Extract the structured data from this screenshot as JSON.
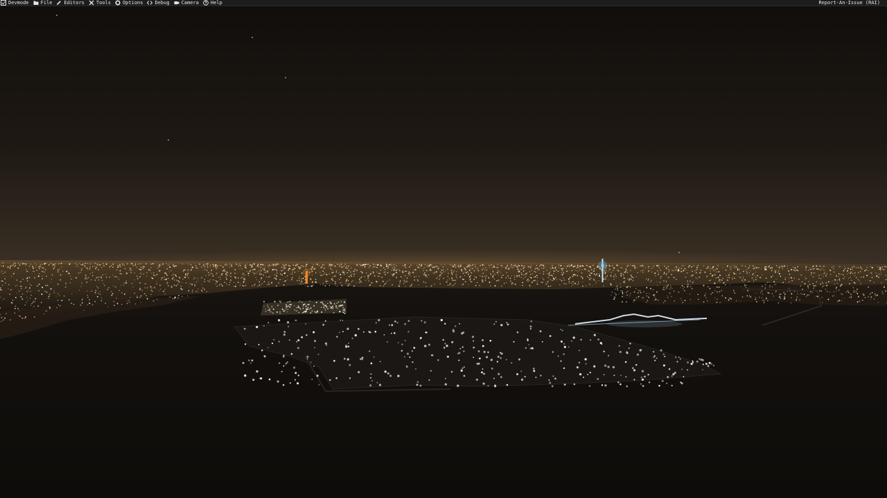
{
  "menubar": {
    "items": [
      {
        "label": "Devmode",
        "icon": "devmode-checkbox-icon"
      },
      {
        "label": "File",
        "icon": "folder-icon"
      },
      {
        "label": "Editors",
        "icon": "pencil-icon"
      },
      {
        "label": "Tools",
        "icon": "wrench-cross-icon"
      },
      {
        "label": "Options",
        "icon": "gear-icon"
      },
      {
        "label": "Debug",
        "icon": "code-brackets-icon"
      },
      {
        "label": "Camera",
        "icon": "camera-icon"
      },
      {
        "label": "Help",
        "icon": "question-circle-icon"
      }
    ],
    "right_link": "Report-An-Issue (RAI)"
  },
  "scene": {
    "colors": {
      "sky_top": "#110e0b",
      "sky_horizon": "#3a2f24",
      "water": "#0e0c0a",
      "city_light": "#ffd89a",
      "airport_light": "#f2f2ea",
      "tower_orange": "#ff8a2a",
      "tower_blue": "#7fd0ff"
    }
  }
}
